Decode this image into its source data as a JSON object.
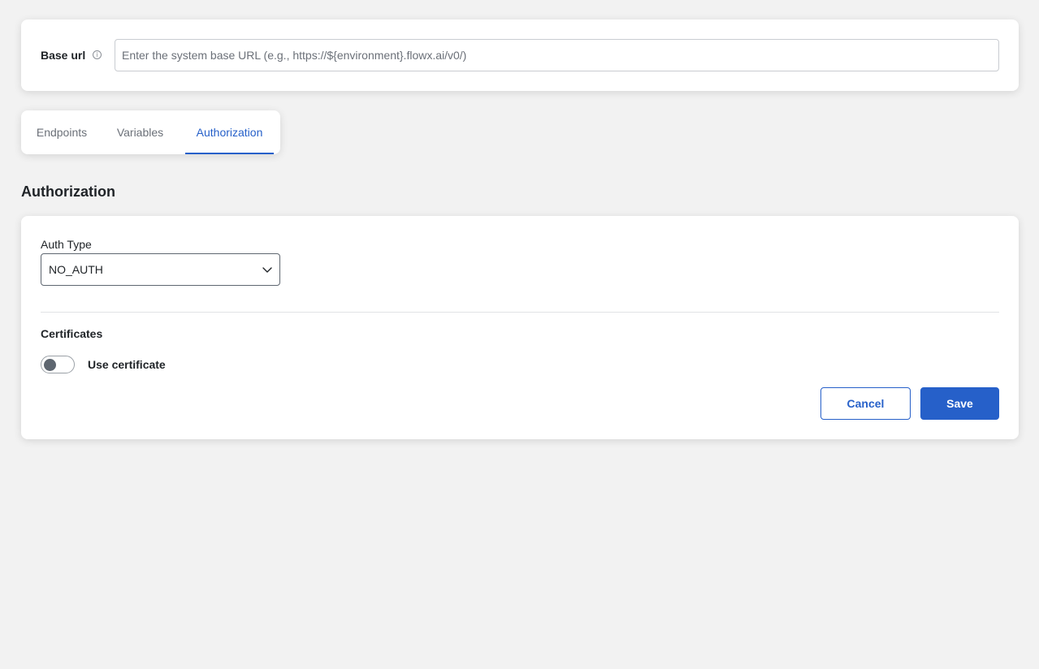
{
  "base_url": {
    "label": "Base url",
    "info_icon": "info-icon",
    "input_value": "",
    "placeholder": "Enter the system base URL (e.g., https://${environment}.flowx.ai/v0/)"
  },
  "tabs": [
    {
      "label": "Endpoints",
      "active": false
    },
    {
      "label": "Variables",
      "active": false
    },
    {
      "label": "Authorization",
      "active": true
    }
  ],
  "section_title": "Authorization",
  "auth": {
    "type_label": "Auth Type",
    "type_value": "NO_AUTH",
    "certificates_label": "Certificates",
    "use_certificate_label": "Use certificate",
    "use_certificate_enabled": false
  },
  "actions": {
    "cancel_label": "Cancel",
    "save_label": "Save"
  },
  "colors": {
    "accent": "#2660c9",
    "background": "#f2f2f2",
    "text": "#1f2327",
    "muted": "#6b7078"
  }
}
